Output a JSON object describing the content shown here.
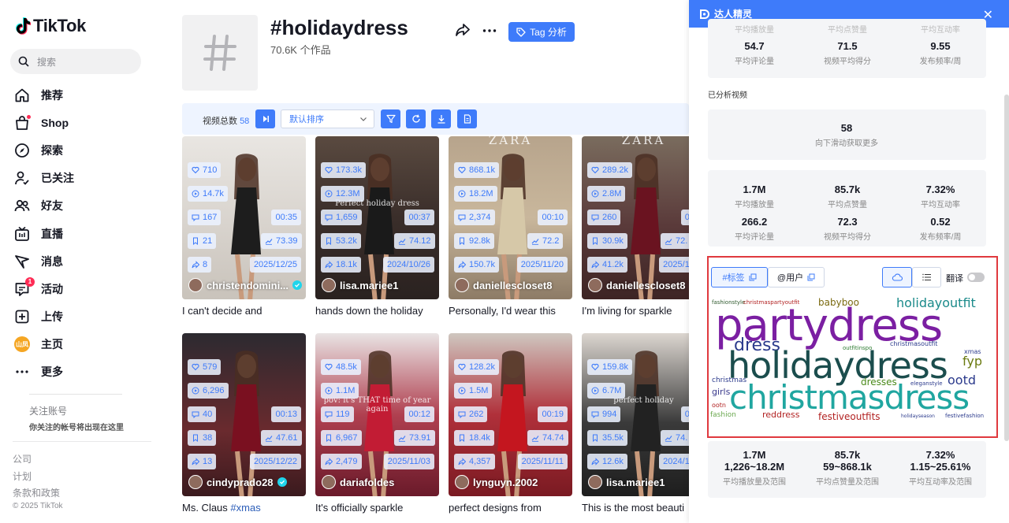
{
  "sidebar": {
    "logo": "TikTok",
    "search_placeholder": "搜索",
    "items": [
      {
        "label": "推荐",
        "icon": "home-icon"
      },
      {
        "label": "Shop",
        "icon": "shop-icon"
      },
      {
        "label": "探索",
        "icon": "compass-icon"
      },
      {
        "label": "已关注",
        "icon": "following-icon"
      },
      {
        "label": "好友",
        "icon": "friends-icon"
      },
      {
        "label": "直播",
        "icon": "live-icon"
      },
      {
        "label": "消息",
        "icon": "message-icon"
      },
      {
        "label": "活动",
        "icon": "activity-icon",
        "badge": "1"
      },
      {
        "label": "上传",
        "icon": "upload-icon"
      },
      {
        "label": "主页",
        "icon": "profile-avatar",
        "avatar_text": "山凤"
      },
      {
        "label": "更多",
        "icon": "more-icon"
      }
    ],
    "follow_title": "关注账号",
    "follow_desc": "你关注的帐号将出现在这里",
    "footer_links": [
      "公司",
      "计划",
      "条款和政策"
    ],
    "copyright": "© 2025 TikTok"
  },
  "header": {
    "tag_title": "#holidaydress",
    "tag_count": "70.6K 个作品",
    "tag_button": "Tag 分析"
  },
  "toolbar": {
    "total_label": "视频总数",
    "total_value": "58",
    "sort_label": "默认排序"
  },
  "videos": [
    {
      "likes": "710",
      "plays": "14.7k",
      "comments": "167",
      "duration": "00:35",
      "saves": "21",
      "score": "73.39",
      "shares": "8",
      "date": "2025/12/25",
      "author": "christendomini...",
      "verified": true,
      "caption": "I can't decide and",
      "hashtag": ""
    },
    {
      "likes": "173.3k",
      "plays": "12.3M",
      "comments": "1,659",
      "duration": "00:37",
      "saves": "53.2k",
      "score": "74.12",
      "shares": "18.1k",
      "date": "2024/10/26",
      "author": "lisa.mariee1",
      "verified": false,
      "caption": "hands down the holiday",
      "hashtag": "",
      "overlay": "Perfect holiday dress"
    },
    {
      "likes": "868.1k",
      "plays": "18.2M",
      "comments": "2,374",
      "duration": "00:10",
      "saves": "92.8k",
      "score": "72.2",
      "shares": "150.7k",
      "date": "2025/11/20",
      "author": "daniellescloset8",
      "verified": false,
      "caption": "Personally, I'd wear this",
      "hashtag": "",
      "overlay": "ZARA"
    },
    {
      "likes": "289.2k",
      "plays": "2.8M",
      "comments": "260",
      "duration": "00:",
      "saves": "30.9k",
      "score": "72.",
      "shares": "41.2k",
      "date": "2025/12/",
      "author": "daniellescloset8",
      "verified": false,
      "caption": "I'm living for sparkle",
      "hashtag": "",
      "overlay": "ZARA"
    },
    {
      "likes": "579",
      "plays": "6,296",
      "comments": "40",
      "duration": "00:13",
      "saves": "38",
      "score": "47.61",
      "shares": "13",
      "date": "2025/12/22",
      "author": "cindyprado28",
      "verified": true,
      "caption": "Ms. Claus ",
      "hashtag": "#xmas"
    },
    {
      "likes": "48.5k",
      "plays": "1.1M",
      "comments": "119",
      "duration": "00:12",
      "saves": "6,967",
      "score": "73.91",
      "shares": "2,479",
      "date": "2025/11/03",
      "author": "dariafoldes",
      "verified": false,
      "caption": "It's officially sparkle",
      "hashtag": "",
      "overlay": "pov: it's THAT time of year again"
    },
    {
      "likes": "128.2k",
      "plays": "1.5M",
      "comments": "262",
      "duration": "00:19",
      "saves": "18.4k",
      "score": "74.74",
      "shares": "4,357",
      "date": "2025/11/11",
      "author": "lynguyn.2002",
      "verified": false,
      "caption": "perfect designs from",
      "hashtag": ""
    },
    {
      "likes": "159.8k",
      "plays": "6.7M",
      "comments": "994",
      "duration": "00:",
      "saves": "35.5k",
      "score": "74.",
      "shares": "12.6k",
      "date": "2024/10/",
      "author": "lisa.mariee1",
      "verified": false,
      "caption": "This is the most beauti",
      "hashtag": "",
      "overlay": "perfect holiday"
    }
  ],
  "panel": {
    "title": "达人精灵",
    "top_partial": [
      "平均播放量",
      "平均点赞量",
      "平均互动率"
    ],
    "top_stats": [
      {
        "value": "54.7",
        "label": "平均评论量"
      },
      {
        "value": "71.5",
        "label": "视频平均得分"
      },
      {
        "value": "9.55",
        "label": "发布频率/周"
      }
    ],
    "analyzed_title": "已分析视频",
    "analyzed_count": "58",
    "analyzed_hint": "向下滑动获取更多",
    "stats_row1": [
      {
        "value": "1.7M",
        "label": "平均播放量"
      },
      {
        "value": "85.7k",
        "label": "平均点赞量"
      },
      {
        "value": "7.32%",
        "label": "平均互动率"
      }
    ],
    "stats_row2": [
      {
        "value": "266.2",
        "label": "平均评论量"
      },
      {
        "value": "72.3",
        "label": "视频平均得分"
      },
      {
        "value": "0.52",
        "label": "发布频率/周"
      }
    ],
    "wordcloud_tabs": {
      "tags": "#标签",
      "users": "@用户",
      "translate": "翻译"
    },
    "wordcloud": [
      {
        "text": "fashionstyle",
        "color": "#2f5a2e"
      },
      {
        "text": "christmaspartyoutfit",
        "color": "#b22222"
      },
      {
        "text": "babyboo",
        "color": "#7a6a10"
      },
      {
        "text": "holidayoutfit",
        "color": "#1a8a8a"
      },
      {
        "text": "partydress",
        "color": "#7b1fa2"
      },
      {
        "text": "dress",
        "color": "#2b3a8c"
      },
      {
        "text": "holidaydress",
        "color": "#1b4d4d"
      },
      {
        "text": "christmasoutfit",
        "color": "#2b3a8c"
      },
      {
        "text": "fyp",
        "color": "#6a7a10"
      },
      {
        "text": "christmas",
        "color": "#2b3a8c"
      },
      {
        "text": "dresses",
        "color": "#4a8a1a"
      },
      {
        "text": "ootd",
        "color": "#2b3a8c"
      },
      {
        "text": "girls",
        "color": "#3a3a8c"
      },
      {
        "text": "christmasdress",
        "color": "#20a6a0"
      },
      {
        "text": "fashion",
        "color": "#6aa84f"
      },
      {
        "text": "reddress",
        "color": "#b22222"
      },
      {
        "text": "festiveoutfits",
        "color": "#b22222"
      },
      {
        "text": "holidayseason",
        "color": "#2b3a8c"
      },
      {
        "text": "festivefashion",
        "color": "#2b3a8c"
      },
      {
        "text": "outfitinspo",
        "color": "#2e7d32"
      },
      {
        "text": "eleganstyle",
        "color": "#2b3a8c"
      },
      {
        "text": "xmas",
        "color": "#2b3a8c"
      },
      {
        "text": "ootn",
        "color": "#b22222"
      }
    ],
    "range_stats": [
      {
        "value": "1.7M",
        "range": "1,226~18.2M",
        "label": "平均播放量及范围"
      },
      {
        "value": "85.7k",
        "range": "59~868.1k",
        "label": "平均点赞量及范围"
      },
      {
        "value": "7.32%",
        "range": "1.15~25.61%",
        "label": "平均互动率及范围"
      }
    ]
  },
  "colors": {
    "accent": "#3e7bfa",
    "highlight_border": "#e0393e",
    "brand_pink": "#fe2c55"
  }
}
